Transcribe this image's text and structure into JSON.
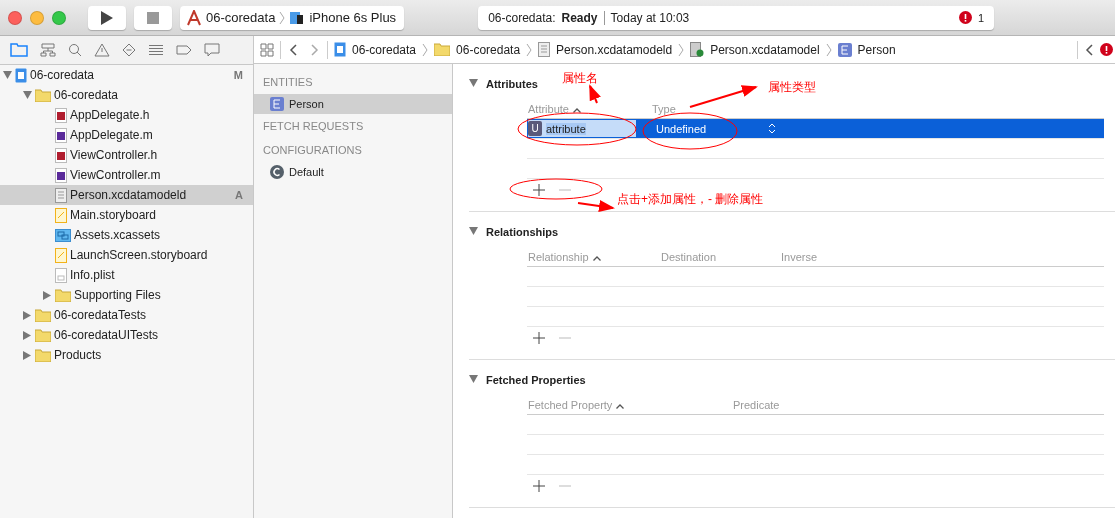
{
  "toolbar": {
    "scheme": "06-coredata",
    "device": "iPhone 6s Plus",
    "status_project": "06-coredata:",
    "status_state": "Ready",
    "status_time": "Today at 10:03",
    "issue_count": "1"
  },
  "jump_bar": [
    "06-coredata",
    "06-coredata",
    "Person.xcdatamodeld",
    "Person.xcdatamodel",
    "Person"
  ],
  "navigator": [
    {
      "kind": "project",
      "name": "06-coredata",
      "badge": "M",
      "selected": false,
      "expanded": true,
      "children": [
        {
          "kind": "folder",
          "name": "06-coredata",
          "selected": false,
          "expanded": true,
          "children": [
            {
              "kind": "h",
              "name": "AppDelegate.h",
              "selected": false
            },
            {
              "kind": "m",
              "name": "AppDelegate.m",
              "selected": false
            },
            {
              "kind": "h",
              "name": "ViewController.h",
              "selected": false
            },
            {
              "kind": "m",
              "name": "ViewController.m",
              "selected": false
            },
            {
              "kind": "model",
              "name": "Person.xcdatamodeld",
              "badge": "A",
              "selected": true
            },
            {
              "kind": "storyboard",
              "name": "Main.storyboard",
              "selected": false
            },
            {
              "kind": "assets",
              "name": "Assets.xcassets",
              "selected": false
            },
            {
              "kind": "storyboard",
              "name": "LaunchScreen.storyboard",
              "selected": false
            },
            {
              "kind": "plist",
              "name": "Info.plist",
              "selected": false
            },
            {
              "kind": "folder",
              "name": "Supporting Files",
              "selected": false,
              "expanded": false
            }
          ]
        },
        {
          "kind": "folder",
          "name": "06-coredataTests",
          "selected": false,
          "expanded": false
        },
        {
          "kind": "folder",
          "name": "06-coredataUITests",
          "selected": false,
          "expanded": false
        },
        {
          "kind": "folder",
          "name": "Products",
          "selected": false,
          "expanded": false
        }
      ]
    }
  ],
  "entity_list": [
    {
      "heading": "ENTITIES",
      "items": [
        {
          "kind": "entity",
          "name": "Person",
          "selected": true
        }
      ]
    },
    {
      "heading": "FETCH REQUESTS"
    },
    {
      "heading": "CONFIGURATIONS",
      "items": [
        {
          "kind": "configuration",
          "name": "Default",
          "selected": false
        }
      ]
    }
  ],
  "sections": [
    {
      "title": "Attributes",
      "columns": [
        "Attribute",
        "Type"
      ],
      "rows": [
        {
          "type_badge": "U",
          "name": "attribute",
          "type": "Undefined",
          "selected": true
        }
      ]
    },
    {
      "title": "Relationships",
      "columns": [
        "Relationship",
        "Destination",
        "Inverse"
      ]
    },
    {
      "title": "Fetched Properties",
      "columns": [
        "Fetched Property",
        "Predicate"
      ]
    }
  ],
  "annotations": [
    "属性名",
    "属性类型",
    "点击+添加属性，- 删除属性"
  ]
}
